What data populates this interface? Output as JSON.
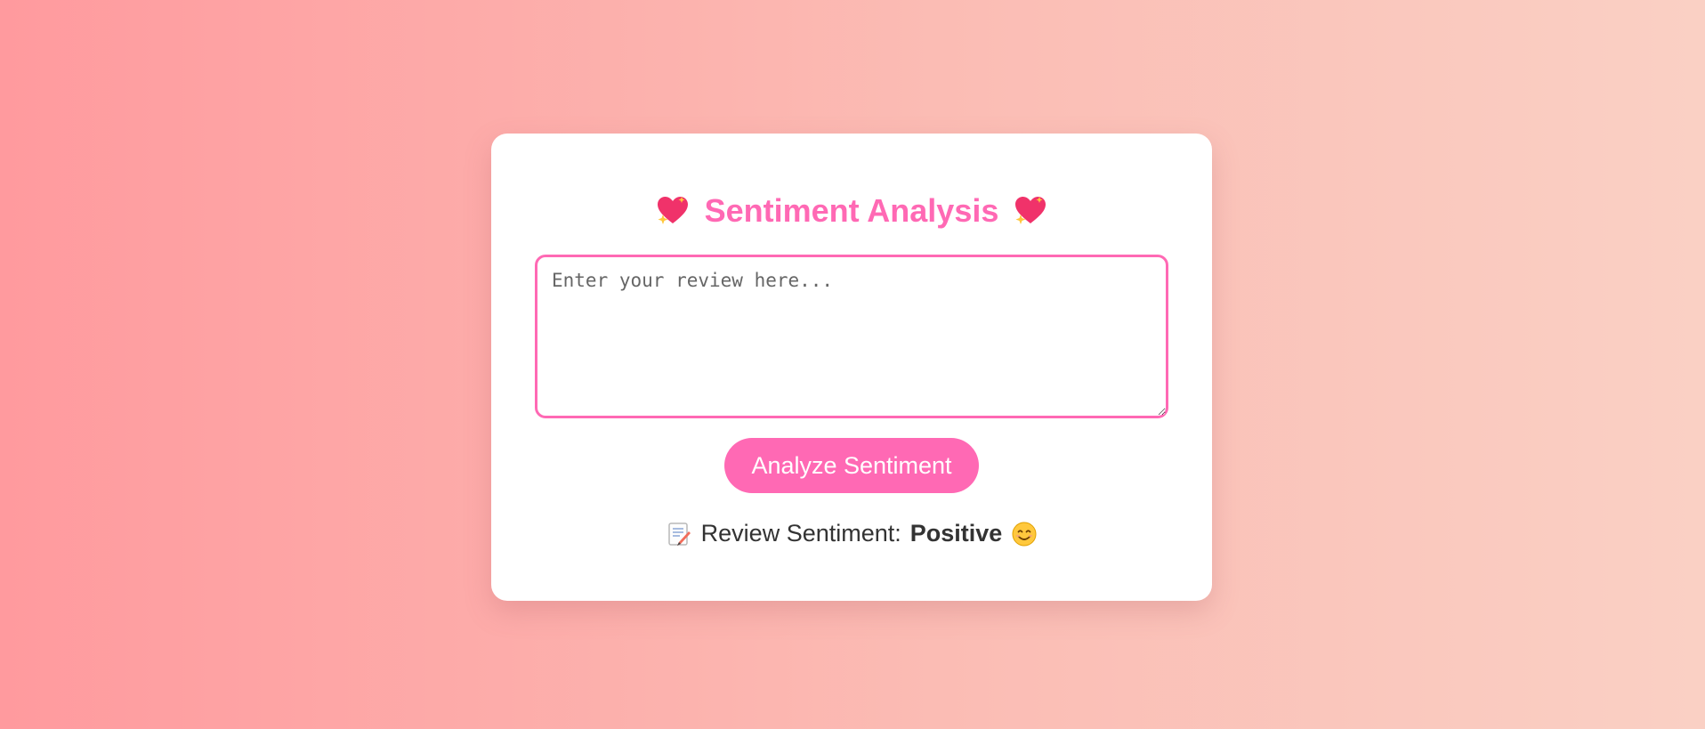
{
  "page": {
    "background_start": "#ff9a9e",
    "background_end": "#fad0c4"
  },
  "card": {
    "title": "Sentiment Analysis",
    "title_icon": "sparkling-heart-icon",
    "title_color": "#ff69b4",
    "review_input": {
      "placeholder": "Enter your review here...",
      "value": ""
    },
    "analyze_button": {
      "label": "Analyze Sentiment",
      "color": "#ff69b4"
    },
    "result": {
      "icon": "memo-icon",
      "label": "Review Sentiment:",
      "value": "Positive",
      "emoji_icon": "smiling-face-icon"
    }
  }
}
